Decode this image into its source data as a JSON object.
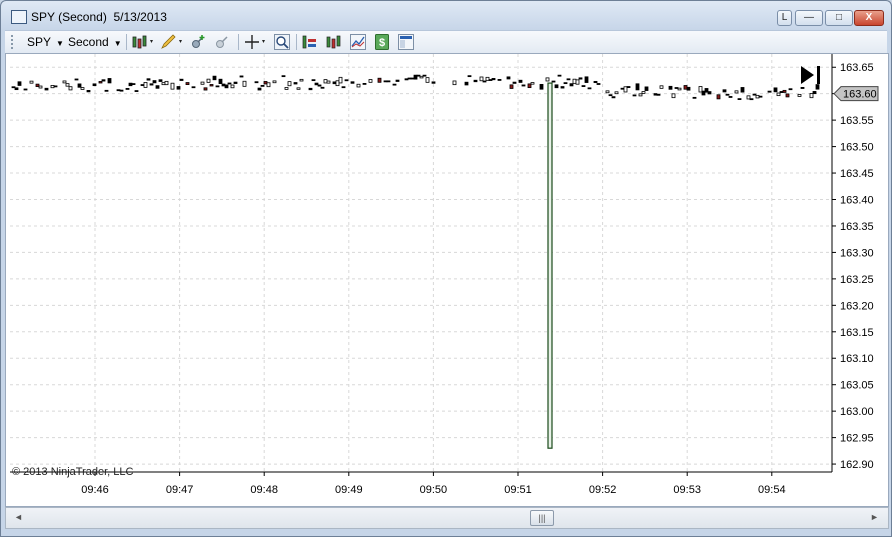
{
  "window": {
    "title": "SPY (Second)  5/13/2013",
    "buttons": {
      "link": "L",
      "minimize": "—",
      "maximize": "□",
      "close": "X"
    }
  },
  "toolbar": {
    "instrument": "SPY",
    "interval": "Second",
    "icons": [
      "bar-type-icon",
      "drawing-pencil-icon",
      "add-indicator-icon",
      "remove-indicator-icon",
      "crosshair-icon",
      "zoom-icon",
      "data-series-icon",
      "indicators-icon",
      "strategies-icon",
      "order-entry-icon",
      "properties-icon"
    ]
  },
  "chart": {
    "watermark": "© 2013 NinjaTrader, LLC",
    "current_price_label": "163.60",
    "accent_color": "#000000",
    "gridline_color": "#d8d8d8"
  },
  "chart_data": {
    "type": "bar",
    "instrument": "SPY",
    "interval": "Second",
    "x_tick_labels": [
      "09:46",
      "09:47",
      "09:48",
      "09:49",
      "09:50",
      "09:51",
      "09:52",
      "09:53",
      "09:54"
    ],
    "y_tick_labels": [
      "163.65",
      "163.60",
      "163.55",
      "163.50",
      "163.45",
      "163.40",
      "163.35",
      "163.30",
      "163.25",
      "163.20",
      "163.15",
      "163.10",
      "163.05",
      "163.00",
      "162.95",
      "162.90"
    ],
    "ylim": [
      162.885,
      163.675
    ],
    "grid": true,
    "last_price": 163.6,
    "notable_bar": {
      "time": "09:51:24",
      "open": 163.62,
      "close": 162.93,
      "high": 163.625,
      "low": 162.93
    },
    "price_band": [
      163.59,
      163.635
    ]
  },
  "scrollbar": {
    "left_arrow": "◄",
    "right_arrow": "►",
    "thumb_grip": "|||"
  }
}
